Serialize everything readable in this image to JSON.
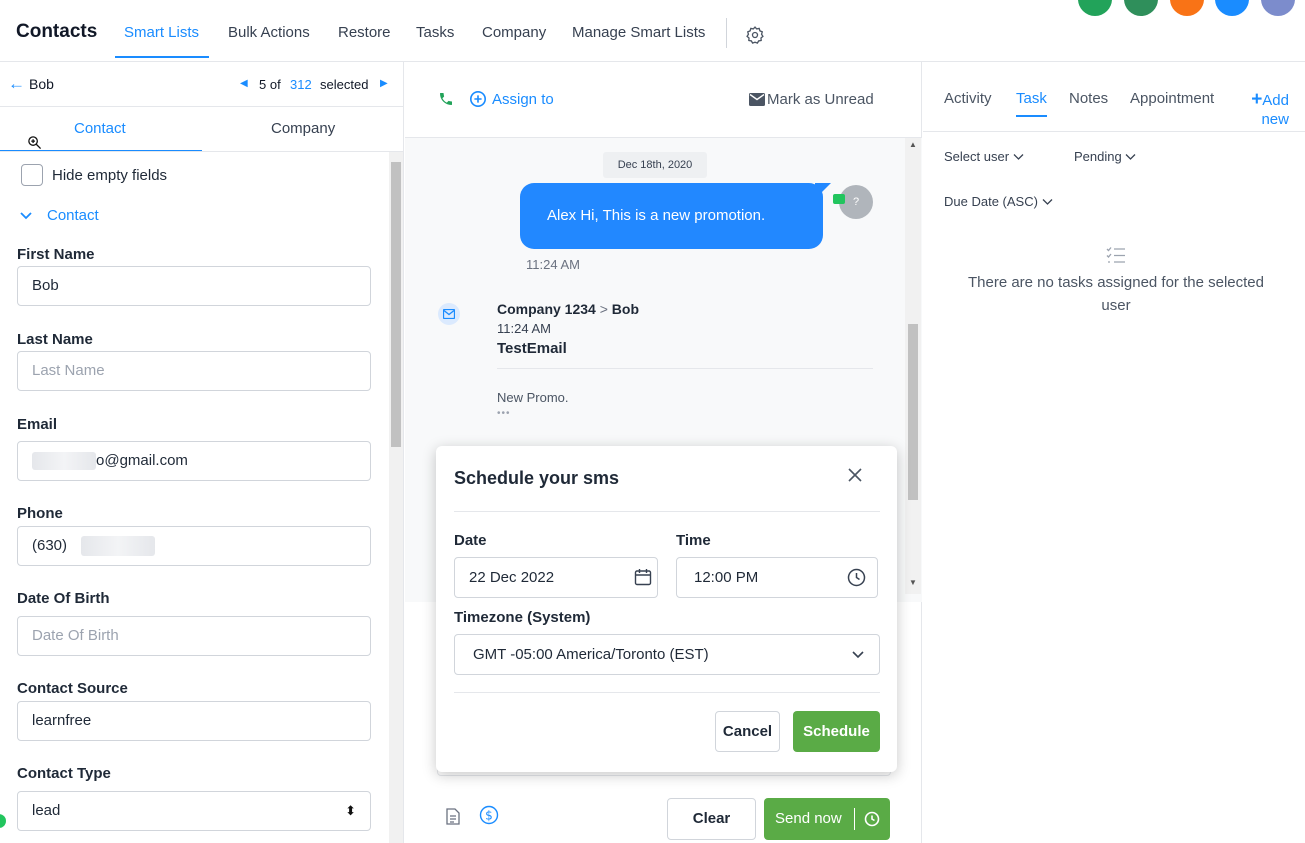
{
  "topnav": {
    "title": "Contacts",
    "tabs": [
      "Smart Lists",
      "Bulk Actions",
      "Restore",
      "Tasks",
      "Company",
      "Manage Smart Lists"
    ]
  },
  "contact_nav": {
    "back_label": "Bob",
    "count_prefix": "5 of",
    "count_total": "312",
    "count_suffix": "selected"
  },
  "left_tabs": {
    "contact": "Contact",
    "company": "Company"
  },
  "hide_empty_label": "Hide empty fields",
  "section_label": "Contact",
  "fields": {
    "first_name": {
      "label": "First Name",
      "value": "Bob"
    },
    "last_name": {
      "label": "Last Name",
      "placeholder": "Last Name"
    },
    "email": {
      "label": "Email",
      "value": "o@gmail.com"
    },
    "phone": {
      "label": "Phone",
      "value": "(630)"
    },
    "dob": {
      "label": "Date Of Birth",
      "placeholder": "Date Of Birth"
    },
    "source": {
      "label": "Contact Source",
      "value": "learnfree"
    },
    "type": {
      "label": "Contact Type",
      "value": "lead"
    }
  },
  "conversation": {
    "assign_label": "Assign to",
    "mark_unread": "Mark as Unread",
    "date_chip": "Dec 18th, 2020",
    "sms_text": "Alex Hi, This is a new promotion.",
    "sms_time": "11:24 AM",
    "email_from": "Company 1234",
    "email_to": "Bob",
    "email_time": "11:24 AM",
    "email_subject": "TestEmail",
    "email_preview": "New Promo.",
    "email_more": "•••"
  },
  "modal": {
    "title": "Schedule your sms",
    "date_label": "Date",
    "date_value": "22 Dec 2022",
    "time_label": "Time",
    "time_value": "12:00 PM",
    "tz_label": "Timezone (System)",
    "tz_value": "GMT -05:00 America/Toronto (EST)",
    "cancel": "Cancel",
    "schedule": "Schedule"
  },
  "composer": {
    "clear": "Clear",
    "send_now": "Send now"
  },
  "right": {
    "tabs": [
      "Activity",
      "Task",
      "Notes",
      "Appointment"
    ],
    "add_new_1": "Add",
    "add_new_2": "new",
    "filter_user": "Select user",
    "filter_status": "Pending",
    "sort": "Due Date (ASC)",
    "empty_text": "There are no tasks assigned for the selected user"
  },
  "colors": {
    "accent": "#1a8cff",
    "green": "#5aab46",
    "bubble": "#2288ff"
  }
}
